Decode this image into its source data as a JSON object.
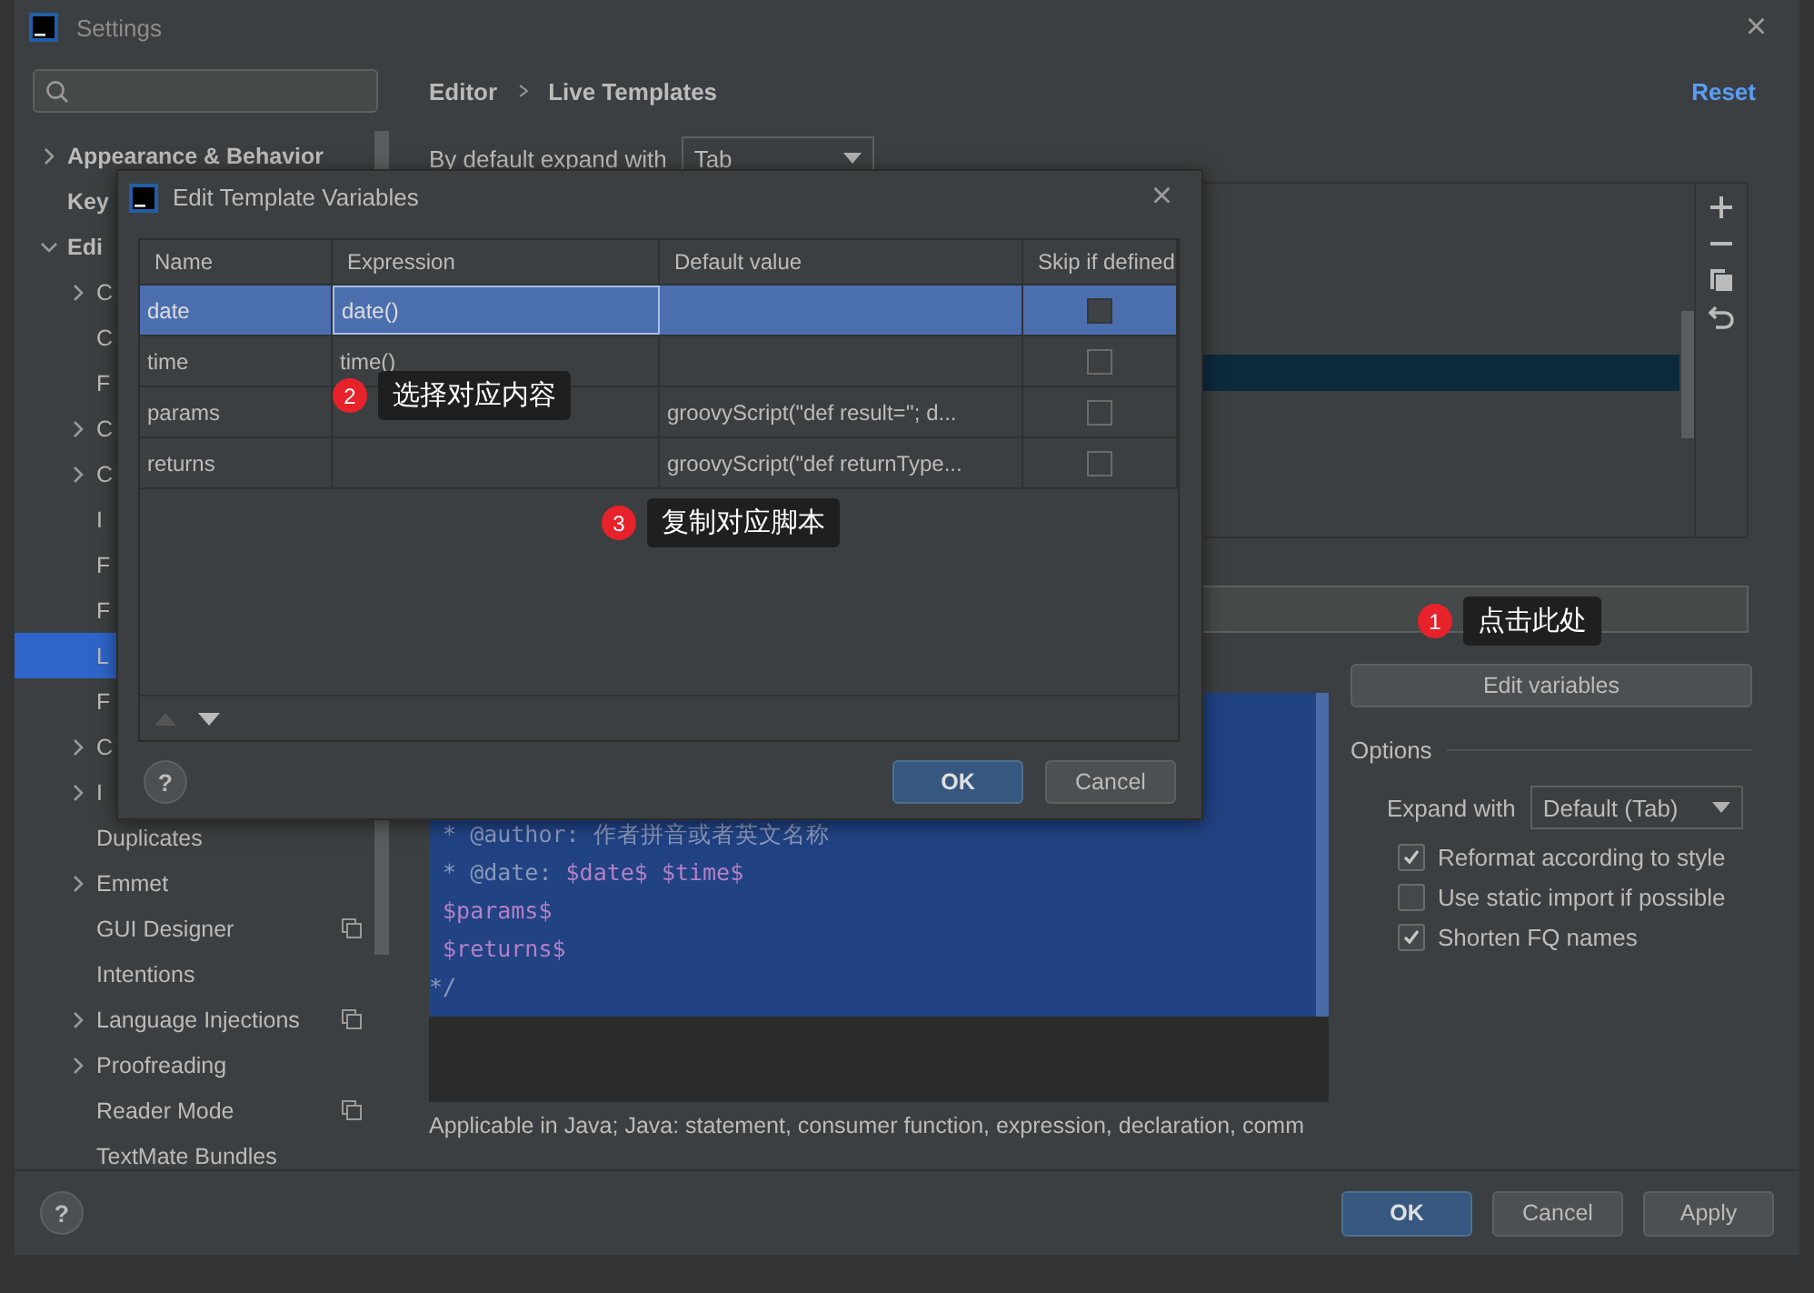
{
  "window": {
    "title": "Settings",
    "close": "×"
  },
  "sidebar": {
    "items": [
      {
        "label": "Appearance & Behavior",
        "expanded": false
      },
      {
        "label": "Key"
      },
      {
        "label": "Edi",
        "expanded": true,
        "children": [
          {
            "label": "C",
            "expanded": false,
            "selected": false
          },
          {
            "label": "C",
            "selected": false
          },
          {
            "label": "F",
            "selected": false
          },
          {
            "label": "C",
            "expanded": false,
            "selected": false
          },
          {
            "label": "C",
            "expanded": false,
            "selected": false
          },
          {
            "label": "I",
            "selected": false
          },
          {
            "label": "F",
            "selected": false
          },
          {
            "label": "F",
            "selected": false
          },
          {
            "label": "L",
            "selected": true
          },
          {
            "label": "F",
            "selected": false
          },
          {
            "label": "C",
            "expanded": false,
            "selected": false
          },
          {
            "label": "I",
            "expanded": false,
            "selected": false
          },
          {
            "label": "Duplicates",
            "selected": false,
            "scoped": false
          },
          {
            "label": "Emmet",
            "expanded": false,
            "selected": false,
            "scoped": false
          },
          {
            "label": "GUI Designer",
            "selected": false,
            "scoped": true
          },
          {
            "label": "Intentions",
            "selected": false,
            "scoped": false
          },
          {
            "label": "Language Injections",
            "expanded": false,
            "selected": false,
            "scoped": true
          },
          {
            "label": "Proofreading",
            "expanded": false,
            "selected": false,
            "scoped": false
          },
          {
            "label": "Reader Mode",
            "selected": false,
            "scoped": true
          },
          {
            "label": "TextMate Bundles",
            "selected": false,
            "scoped": false
          }
        ]
      }
    ]
  },
  "breadcrumb": [
    "Editor",
    "Live Templates"
  ],
  "reset": "Reset",
  "expand_default": {
    "label": "By default expand with",
    "value": "Tab"
  },
  "edit_variables": "Edit variables",
  "template_text": [
    [
      {
        "kind": "doc",
        "text": " * @author: 作者拼音或者英文名称"
      }
    ],
    [
      {
        "kind": "doc",
        "text": " * @date: "
      },
      {
        "kind": "var",
        "text": "$date$ $time$"
      }
    ],
    [
      {
        "kind": "var",
        "text": " $params$"
      }
    ],
    [
      {
        "kind": "var",
        "text": " $returns$"
      }
    ],
    [
      {
        "kind": "doc",
        "text": "*/"
      }
    ]
  ],
  "applicable": "Applicable in Java; Java: statement, consumer function, expression, declaration, comm",
  "options": {
    "title": "Options",
    "expand_with": {
      "label": "Expand with",
      "value": "Default (Tab)"
    },
    "checkboxes": [
      {
        "label": "Reformat according to style",
        "checked": true
      },
      {
        "label": "Use static import if possible",
        "checked": false
      },
      {
        "label": "Shorten FQ names",
        "checked": true
      }
    ]
  },
  "help": "?",
  "footer_buttons": [
    {
      "label": "OK",
      "default": true
    },
    {
      "label": "Cancel",
      "default": false
    },
    {
      "label": "Apply",
      "default": false
    }
  ],
  "dialog": {
    "title": "Edit Template Variables",
    "close": "×",
    "columns": [
      "Name",
      "Expression",
      "Default value",
      "Skip if defined"
    ],
    "rows": [
      {
        "name": "date",
        "expression": "date()",
        "default_value": "",
        "skip": false,
        "selected": true
      },
      {
        "name": "time",
        "expression": "time()",
        "default_value": "",
        "skip": false,
        "selected": false
      },
      {
        "name": "params",
        "expression": "",
        "default_value": "groovyScript(\"def result=''; d...",
        "skip": false,
        "selected": false
      },
      {
        "name": "returns",
        "expression": "",
        "default_value": "groovyScript(\"def returnType...",
        "skip": false,
        "selected": false
      }
    ],
    "buttons": [
      {
        "label": "OK",
        "default": true
      },
      {
        "label": "Cancel",
        "default": false
      }
    ]
  },
  "annotations": [
    {
      "number": "1",
      "text": "点击此处"
    },
    {
      "number": "2",
      "text": "选择对应内容"
    },
    {
      "number": "3",
      "text": "复制对应脚本"
    }
  ]
}
